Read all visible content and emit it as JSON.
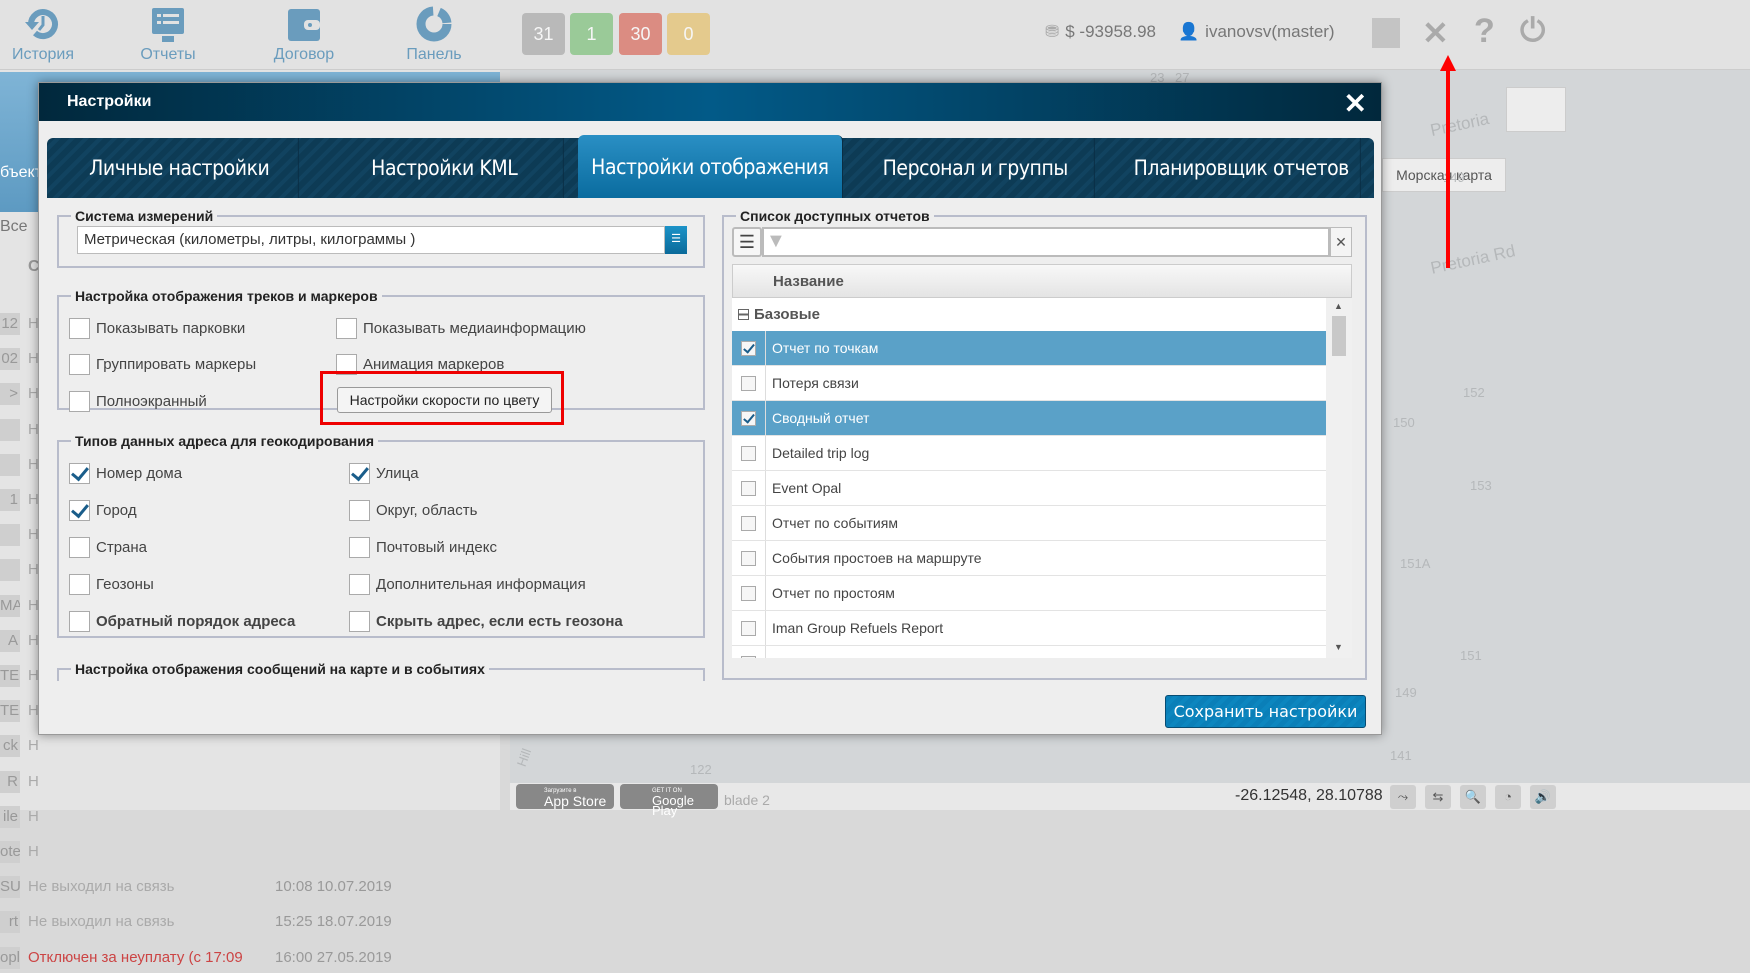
{
  "topbar": {
    "nav": [
      {
        "label": "История",
        "icon": "history-icon"
      },
      {
        "label": "Отчеты",
        "icon": "reports-icon"
      },
      {
        "label": "Договор",
        "icon": "wallet-icon"
      },
      {
        "label": "Панель",
        "icon": "dashboard-icon"
      }
    ],
    "counters": [
      {
        "value": "31",
        "color": "#a8a8a8"
      },
      {
        "value": "1",
        "color": "#7cc17a"
      },
      {
        "value": "30",
        "color": "#d9695a"
      },
      {
        "value": "0",
        "color": "#e5c16a"
      }
    ],
    "balance": "$ -93958.98",
    "user": "ivanovsv(master)"
  },
  "map": {
    "sea_map_label": "Морская карта",
    "labels": [
      "Pretoria Rd",
      "Pretoria",
      "149",
      "152",
      "150",
      "153",
      "151A",
      "151",
      "149",
      "141",
      "122",
      "23",
      "27",
      "Hill"
    ]
  },
  "left_panel": {
    "object_label": "бъект",
    "filter_all": "Все",
    "col_header": "С",
    "rows": [
      {
        "code": "12",
        "status": "Н"
      },
      {
        "code": "02",
        "status": "Н"
      },
      {
        "code": ">",
        "status": "Н"
      },
      {
        "code": "",
        "status": "Н"
      },
      {
        "code": "",
        "status": "Н"
      },
      {
        "code": "1",
        "status": "Н"
      },
      {
        "code": "",
        "status": "Н"
      },
      {
        "code": "",
        "status": "Н"
      },
      {
        "code": "MA",
        "status": "Н"
      },
      {
        "code": "A",
        "status": "Н"
      },
      {
        "code": "TE",
        "status": "Н"
      },
      {
        "code": "TE",
        "status": "Н"
      },
      {
        "code": "ck",
        "status": "Н"
      },
      {
        "code": "R",
        "status": "Н"
      },
      {
        "code": "ile",
        "status": "Н"
      },
      {
        "code": "ote",
        "status": "Н"
      },
      {
        "code": "SU",
        "status": "Не выходил на связь",
        "time": "10:08 10.07.2019"
      },
      {
        "code": "rt",
        "status": "Не выходил на связь",
        "time": "15:25 18.07.2019"
      },
      {
        "code": "opl",
        "status": "Отключен за неуплату (с 17:09",
        "time": "16:00 27.05.2019",
        "alert": true
      }
    ]
  },
  "bottombar": {
    "app_store": "App Store",
    "app_store_small": "Загрузите в",
    "google_play": "Google Play",
    "google_play_small": "GET IT ON",
    "layer_text": "blade 2",
    "coords": "-26.12548, 28.10788"
  },
  "dialog": {
    "title": "Настройки",
    "tabs": [
      {
        "label": "Личные настройки"
      },
      {
        "label": "Настройки KML"
      },
      {
        "label": "Настройки отображения",
        "active": true
      },
      {
        "label": "Персонал и группы"
      },
      {
        "label": "Планировщик отчетов"
      }
    ],
    "units": {
      "legend": "Система измерений",
      "value": "Метрическая (километры, литры, килограммы )"
    },
    "tracks": {
      "legend": "Настройка отображения треков и маркеров",
      "options": [
        {
          "label": "Показывать парковки",
          "checked": false
        },
        {
          "label": "Показывать медиаинформацию",
          "checked": false
        },
        {
          "label": "Группировать маркеры",
          "checked": false
        },
        {
          "label": "Анимация маркеров",
          "checked": false
        },
        {
          "label": "Полноэкранный",
          "checked": false
        }
      ],
      "speed_button": "Настройки скорости по цвету"
    },
    "geocoding": {
      "legend": "Типов данных адреса для геокодирования",
      "options": [
        {
          "label": "Номер дома",
          "checked": true
        },
        {
          "label": "Улица",
          "checked": true
        },
        {
          "label": "Город",
          "checked": true
        },
        {
          "label": "Округ, область",
          "checked": false
        },
        {
          "label": "Страна",
          "checked": false
        },
        {
          "label": "Почтовый индекс",
          "checked": false
        },
        {
          "label": "Геозоны",
          "checked": false
        },
        {
          "label": "Дополнительная информация",
          "checked": false
        },
        {
          "label": "Обратный порядок адреса",
          "checked": false,
          "bold": true
        },
        {
          "label": "Скрыть адрес, если есть геозона",
          "checked": false,
          "bold": true
        }
      ]
    },
    "messages": {
      "legend": "Настройка отображения сообщений на карте и в событиях"
    },
    "reports": {
      "legend": "Список доступных отчетов",
      "search_value": "",
      "column": "Название",
      "group": "Базовые",
      "items": [
        {
          "name": "Отчет по точкам",
          "checked": true
        },
        {
          "name": "Потеря связи",
          "checked": false
        },
        {
          "name": "Сводный отчет",
          "checked": true
        },
        {
          "name": "Detailed trip log",
          "checked": false
        },
        {
          "name": "Event Opal",
          "checked": false
        },
        {
          "name": "Отчет по событиям",
          "checked": false
        },
        {
          "name": "События простоев на маршруте",
          "checked": false
        },
        {
          "name": "Отчет по простоям",
          "checked": false
        },
        {
          "name": "Iman Group Refuels Report",
          "checked": false
        },
        {
          "name": "",
          "checked": false
        }
      ]
    },
    "save": "Сохранить настройки"
  },
  "annotation_color": "#ff0000"
}
